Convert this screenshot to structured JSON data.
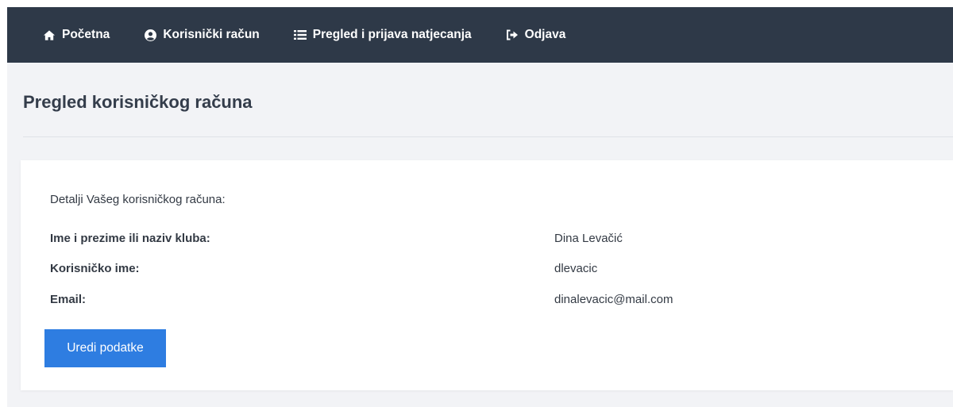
{
  "navbar": {
    "items": [
      {
        "label": "Početna",
        "icon": "home-icon"
      },
      {
        "label": "Korisnički račun",
        "icon": "user-circle-icon"
      },
      {
        "label": "Pregled i prijava natjecanja",
        "icon": "list-icon"
      },
      {
        "label": "Odjava",
        "icon": "sign-out-icon"
      }
    ]
  },
  "page": {
    "title": "Pregled korisničkog računa"
  },
  "card": {
    "intro": "Detalji Vašeg korisničkog računa:",
    "fields": [
      {
        "label": "Ime i prezime ili naziv kluba:",
        "value": "Dina Levačić"
      },
      {
        "label": "Korisničko ime:",
        "value": "dlevacic"
      },
      {
        "label": "Email:",
        "value": "dinalevacic@mail.com"
      }
    ],
    "edit_button_label": "Uredi podatke"
  },
  "colors": {
    "navbar_bg": "#2e3948",
    "page_bg": "#f2f3f6",
    "accent": "#2e7de1",
    "text": "#333a44"
  }
}
